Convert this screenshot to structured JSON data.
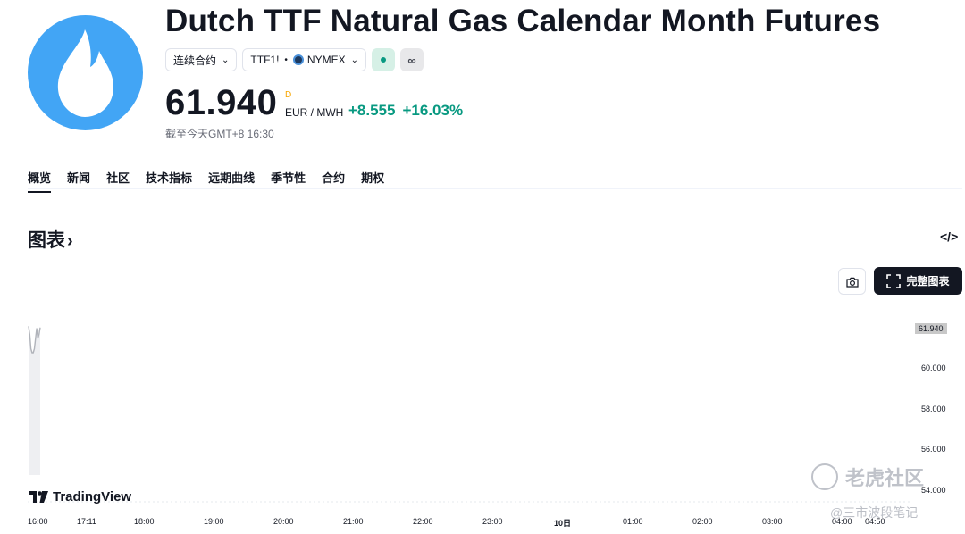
{
  "header": {
    "title": "Dutch TTF Natural Gas Calendar Month Futures",
    "contract_type": "连续合约",
    "symbol": "TTF1!",
    "exchange": "NYMEX",
    "infinity_glyph": "∞",
    "price": "61.940",
    "price_flag": "D",
    "unit": "EUR / MWH",
    "change_abs": "+8.555",
    "change_pct": "+16.03%",
    "as_of": "截至今天GMT+8 16:30"
  },
  "icons": {
    "logo": "flame-icon",
    "chevron": "chevron-down-icon",
    "embed": "embed-code-icon",
    "camera": "camera-icon",
    "fullscreen": "fullscreen-icon"
  },
  "tabs": [
    {
      "label": "概览"
    },
    {
      "label": "新闻"
    },
    {
      "label": "社区"
    },
    {
      "label": "技术指标"
    },
    {
      "label": "远期曲线"
    },
    {
      "label": "季节性"
    },
    {
      "label": "合约"
    },
    {
      "label": "期权"
    }
  ],
  "chart_section": {
    "title": "图表",
    "arrow": "›",
    "embed_label": "</>",
    "full_chart_label": "完整图表",
    "tradingview_label": "TradingView"
  },
  "chart_data": {
    "type": "line",
    "current_value_label": "61.940",
    "y_ticks": [
      "60.000",
      "58.000",
      "56.000",
      "54.000"
    ],
    "x_ticks": [
      "16:00",
      "17:11",
      "18:00",
      "19:00",
      "20:00",
      "21:00",
      "22:00",
      "23:00",
      "10日",
      "01:00",
      "02:00",
      "03:00",
      "04:00",
      "04:50"
    ],
    "series": [
      {
        "values": [
          62.0,
          61.6,
          60.9,
          60.7,
          60.7,
          60.9,
          61.4,
          61.9,
          61.4,
          61.6,
          61.94
        ]
      }
    ],
    "ylim": [
      53.5,
      62.3
    ],
    "colors": {
      "line": "#b0b3ba",
      "area": "#eeeff2"
    }
  },
  "watermark": {
    "brand": "老虎社区",
    "author": "@三市波段笔记"
  }
}
